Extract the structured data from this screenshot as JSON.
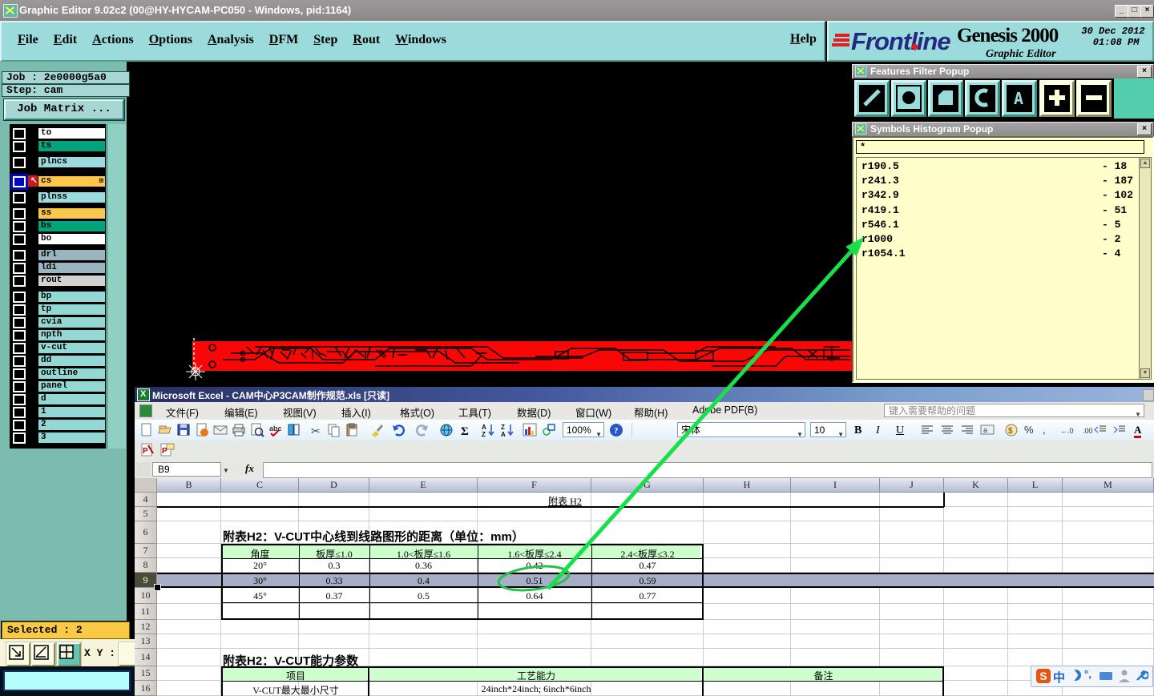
{
  "window": {
    "title": "Graphic Editor 9.02c2 (00@HY-HYCAM-PC050 - Windows, pid:1164)"
  },
  "menu": {
    "items": [
      "File",
      "Edit",
      "Actions",
      "Options",
      "Analysis",
      "DFM",
      "Step",
      "Rout",
      "Windows"
    ],
    "help": "Help"
  },
  "banner": {
    "brand": "Frontline",
    "product": "Genesis 2000",
    "date": "30 Dec 2012",
    "time": "01:08 PM",
    "subtitle": "Graphic Editor"
  },
  "job_panel": {
    "job": "Job : 2e0000g5a0",
    "step": "Step: cam",
    "matrix_button": "Job Matrix ..."
  },
  "layers": [
    {
      "name": "to",
      "color": "#ffffff"
    },
    {
      "name": "ts",
      "color": "#02a47d"
    },
    {
      "name": "plncs",
      "color": "#9bdadf"
    },
    {
      "name": "cs",
      "color": "#fec64b",
      "selected": true
    },
    {
      "name": "plnss",
      "color": "#9bdadf"
    },
    {
      "name": "ss",
      "color": "#fac84d"
    },
    {
      "name": "bs",
      "color": "#02a47b"
    },
    {
      "name": "bo",
      "color": "#ffffff"
    },
    {
      "name": "drl",
      "color": "#9ab5c0"
    },
    {
      "name": "ldi",
      "color": "#9ab5c0"
    },
    {
      "name": "rout",
      "color": "#d2d2d2"
    },
    {
      "name": "bp",
      "color": "#93d8d2"
    },
    {
      "name": "tp",
      "color": "#93d8d2"
    },
    {
      "name": "cvia",
      "color": "#93d8d2"
    },
    {
      "name": "npth",
      "color": "#93d8d2"
    },
    {
      "name": "v-cut",
      "color": "#93d8d2"
    },
    {
      "name": "dd",
      "color": "#93d8d2"
    },
    {
      "name": "outline",
      "color": "#93d8d2"
    },
    {
      "name": "panel",
      "color": "#93d8d2"
    },
    {
      "name": "d",
      "color": "#93d8d2"
    },
    {
      "name": "1",
      "color": "#93d8d2"
    },
    {
      "name": "2",
      "color": "#93d8d2"
    },
    {
      "name": "3",
      "color": "#93d8d2"
    }
  ],
  "status": {
    "selected": "Selected : 2",
    "xy": "X Y :"
  },
  "features_filter": {
    "title": "Features Filter Popup",
    "buttons": [
      "lines-filter",
      "pads-filter",
      "surfaces-filter",
      "arcs-filter",
      "text-filter",
      "include-filter",
      "exclude-filter"
    ]
  },
  "histogram": {
    "title": "Symbols Histogram Popup",
    "filter": "*",
    "rows": [
      {
        "name": "r190.5",
        "count": "18"
      },
      {
        "name": "r241.3",
        "count": "187"
      },
      {
        "name": "r342.9",
        "count": "102"
      },
      {
        "name": "r419.1",
        "count": "51"
      },
      {
        "name": "r546.1",
        "count": "5"
      },
      {
        "name": "r1000",
        "count": "2"
      },
      {
        "name": "r1054.1",
        "count": "4"
      }
    ]
  },
  "excel": {
    "title": "Microsoft Excel - CAM中心P3CAM制作规范.xls [只读]",
    "menus": [
      "文件(F)",
      "编辑(E)",
      "视图(V)",
      "插入(I)",
      "格式(O)",
      "工具(T)",
      "数据(D)",
      "窗口(W)",
      "帮助(H)",
      "Adobe PDF(B)"
    ],
    "help_box": "键入需要帮助的问题",
    "zoom": "100%",
    "font_name": "宋体",
    "font_size": "10",
    "name_box": "B9",
    "fx_label": "fx",
    "columns": [
      "B",
      "C",
      "D",
      "E",
      "F",
      "G",
      "H",
      "I",
      "J",
      "K",
      "L",
      "M"
    ],
    "rows": [
      "4",
      "5",
      "6",
      "7",
      "8",
      "9",
      "10",
      "11",
      "12",
      "13",
      "14",
      "15",
      "16"
    ],
    "sheet": {
      "caption": "附表 H2",
      "table1_title": "附表H2：V-CUT中心线到线路图形的距离（单位：mm）",
      "table1_headers": [
        "角度",
        "板厚≤1.0",
        "1.0<板厚≤1.6",
        "1.6<板厚≤2.4",
        "2.4<板厚≤3.2"
      ],
      "table1_rows": [
        [
          "20°",
          "0.3",
          "0.36",
          "0.42",
          "0.47"
        ],
        [
          "30°",
          "0.33",
          "0.4",
          "0.51",
          "0.59"
        ],
        [
          "45°",
          "0.37",
          "0.5",
          "0.64",
          "0.77"
        ]
      ],
      "table2_title": "附表H2：V-CUT能力参数",
      "table2_headers": [
        "项目",
        "工艺能力",
        "备注"
      ],
      "table2_row": [
        "V-CUT最大最小尺寸",
        "24inch*24inch; 6inch*6inch"
      ]
    }
  },
  "chart_data": {
    "type": "table",
    "title": "附表H2：V-CUT中心线到线路图形的距离（单位：mm）",
    "categories": [
      "20°",
      "30°",
      "45°"
    ],
    "series": [
      {
        "name": "板厚≤1.0",
        "values": [
          0.3,
          0.33,
          0.37
        ]
      },
      {
        "name": "1.0<板厚≤1.6",
        "values": [
          0.36,
          0.4,
          0.5
        ]
      },
      {
        "name": "1.6<板厚≤2.4",
        "values": [
          0.42,
          0.51,
          0.64
        ]
      },
      {
        "name": "2.4<板厚≤3.2",
        "values": [
          0.47,
          0.59,
          0.77
        ]
      }
    ]
  },
  "ime": {
    "icons": [
      "sogou-logo",
      "chinese-mode",
      "moon",
      "punctuation",
      "keyboard",
      "user",
      "wrench"
    ]
  },
  "annotation": {
    "color": "#1fd549"
  }
}
